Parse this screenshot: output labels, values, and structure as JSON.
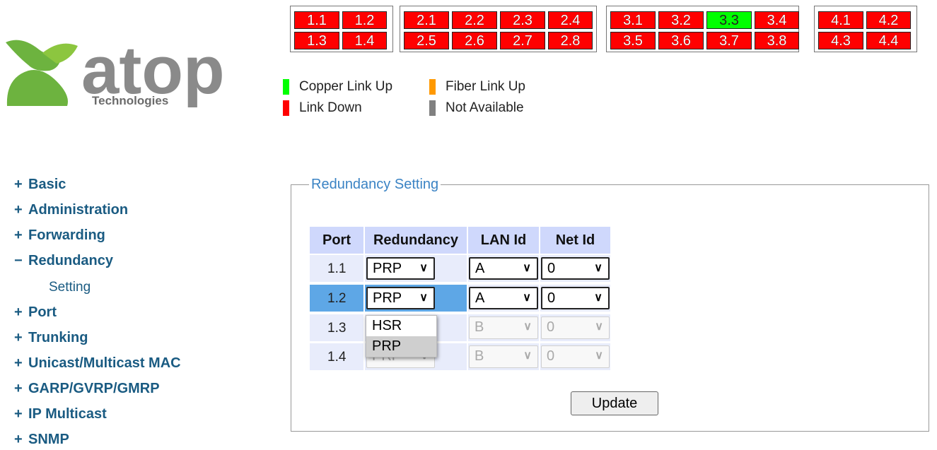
{
  "logo": {
    "brand": "atop",
    "sub": "Technologies"
  },
  "ports": {
    "groups": [
      {
        "row1": [
          {
            "label": "1.1",
            "status": "down"
          },
          {
            "label": "1.2",
            "status": "down"
          }
        ],
        "row2": [
          {
            "label": "1.3",
            "status": "down"
          },
          {
            "label": "1.4",
            "status": "down"
          }
        ]
      },
      {
        "row1": [
          {
            "label": "2.1",
            "status": "down"
          },
          {
            "label": "2.2",
            "status": "down"
          },
          {
            "label": "2.3",
            "status": "down"
          },
          {
            "label": "2.4",
            "status": "down"
          }
        ],
        "row2": [
          {
            "label": "2.5",
            "status": "down"
          },
          {
            "label": "2.6",
            "status": "down"
          },
          {
            "label": "2.7",
            "status": "down"
          },
          {
            "label": "2.8",
            "status": "down"
          }
        ]
      },
      {
        "row1": [
          {
            "label": "3.1",
            "status": "down"
          },
          {
            "label": "3.2",
            "status": "down"
          },
          {
            "label": "3.3",
            "status": "copper-up"
          },
          {
            "label": "3.4",
            "status": "down"
          }
        ],
        "row2": [
          {
            "label": "3.5",
            "status": "down"
          },
          {
            "label": "3.6",
            "status": "down"
          },
          {
            "label": "3.7",
            "status": "down"
          },
          {
            "label": "3.8",
            "status": "down"
          }
        ]
      },
      {
        "row1": [
          {
            "label": "4.1",
            "status": "down"
          },
          {
            "label": "4.2",
            "status": "down"
          }
        ],
        "row2": [
          {
            "label": "4.3",
            "status": "down"
          },
          {
            "label": "4.4",
            "status": "down"
          }
        ]
      }
    ]
  },
  "legend": {
    "copper": {
      "label": "Copper Link Up",
      "color": "#00ff00"
    },
    "fiber": {
      "label": "Fiber Link Up",
      "color": "#ff9900"
    },
    "down": {
      "label": "Link Down",
      "color": "#ff0000"
    },
    "na": {
      "label": "Not Available",
      "color": "#808080"
    }
  },
  "menu": {
    "items": [
      {
        "sign": "+",
        "label": "Basic"
      },
      {
        "sign": "+",
        "label": "Administration"
      },
      {
        "sign": "+",
        "label": "Forwarding"
      },
      {
        "sign": "−",
        "label": "Redundancy"
      },
      {
        "sign": "+",
        "label": "Port"
      },
      {
        "sign": "+",
        "label": "Trunking"
      },
      {
        "sign": "+",
        "label": "Unicast/Multicast MAC"
      },
      {
        "sign": "+",
        "label": "GARP/GVRP/GMRP"
      },
      {
        "sign": "+",
        "label": "IP Multicast"
      },
      {
        "sign": "+",
        "label": "SNMP"
      }
    ],
    "sub": "Setting"
  },
  "panel": {
    "title": "Redundancy Setting",
    "headers": {
      "port": "Port",
      "redundancy": "Redundancy",
      "lan": "LAN Id",
      "net": "Net Id"
    },
    "rows": [
      {
        "port": "1.1",
        "redundancy": "PRP",
        "lan": "A",
        "net": "0"
      },
      {
        "port": "1.2",
        "redundancy": "PRP",
        "lan": "A",
        "net": "0"
      },
      {
        "port": "1.3",
        "redundancy": "",
        "lan": "B",
        "net": "0"
      },
      {
        "port": "1.4",
        "redundancy": "PRP",
        "lan": "B",
        "net": "0"
      }
    ],
    "dropdown": [
      "HSR",
      "PRP"
    ],
    "update": "Update"
  }
}
